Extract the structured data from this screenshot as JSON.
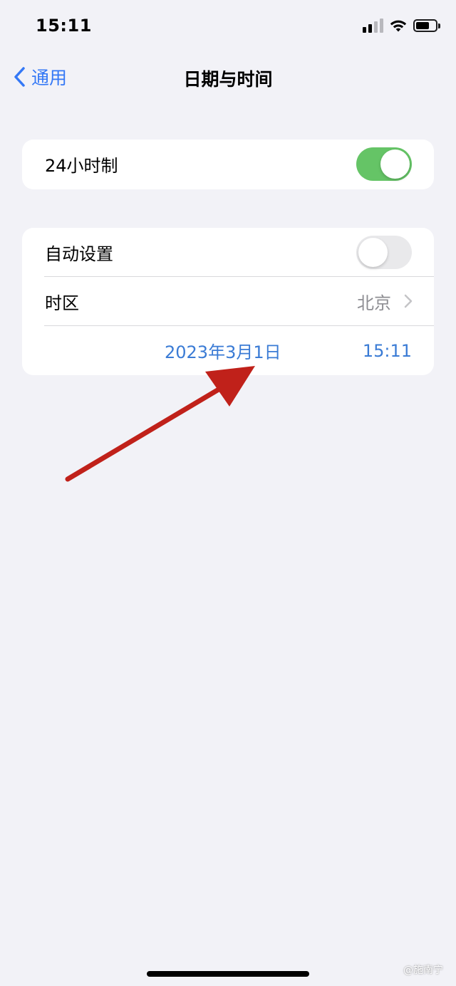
{
  "status_bar": {
    "time": "15:11"
  },
  "nav": {
    "back_label": "通用",
    "title": "日期与时间"
  },
  "settings": {
    "hour24": {
      "label": "24小时制",
      "enabled": true
    },
    "auto_set": {
      "label": "自动设置",
      "enabled": false
    },
    "timezone": {
      "label": "时区",
      "value": "北京"
    },
    "date": "2023年3月1日",
    "time": "15:11"
  },
  "watermark": "@施南宁",
  "colors": {
    "accent": "#3478f6",
    "toggle_on": "#65c466",
    "annotation_arrow": "#c0211a"
  }
}
